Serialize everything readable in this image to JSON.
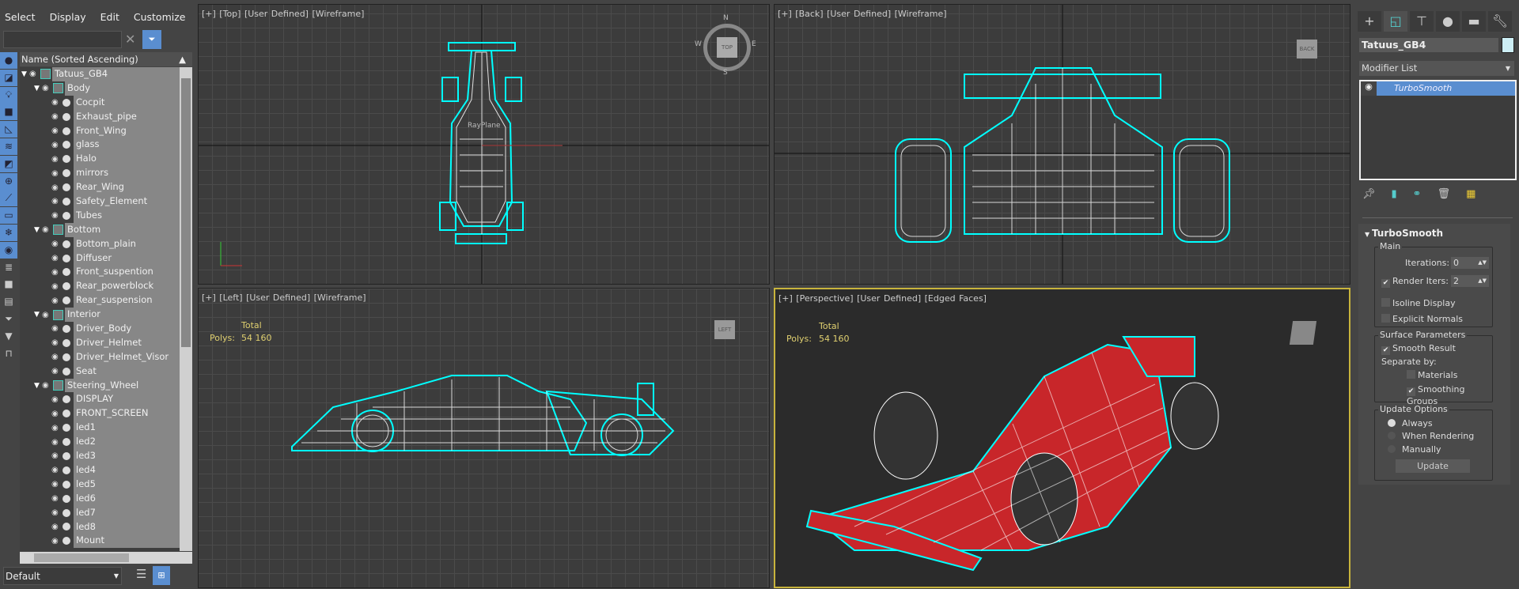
{
  "explorer": {
    "menu": [
      "Select",
      "Display",
      "Edit",
      "Customize"
    ],
    "search_value": "",
    "column_header": "Name (Sorted Ascending)",
    "tree": [
      {
        "label": "Tatuus_GB4",
        "level": 0,
        "type": "group"
      },
      {
        "label": "Body",
        "level": 1,
        "type": "group"
      },
      {
        "label": "Cocpit",
        "level": 2,
        "type": "object"
      },
      {
        "label": "Exhaust_pipe",
        "level": 2,
        "type": "object"
      },
      {
        "label": "Front_Wing",
        "level": 2,
        "type": "object"
      },
      {
        "label": "glass",
        "level": 2,
        "type": "object"
      },
      {
        "label": "Halo",
        "level": 2,
        "type": "object"
      },
      {
        "label": "mirrors",
        "level": 2,
        "type": "object"
      },
      {
        "label": "Rear_Wing",
        "level": 2,
        "type": "object"
      },
      {
        "label": "Safety_Element",
        "level": 2,
        "type": "object"
      },
      {
        "label": "Tubes",
        "level": 2,
        "type": "object"
      },
      {
        "label": "Bottom",
        "level": 1,
        "type": "group"
      },
      {
        "label": "Bottom_plain",
        "level": 2,
        "type": "object"
      },
      {
        "label": "Diffuser",
        "level": 2,
        "type": "object"
      },
      {
        "label": "Front_suspention",
        "level": 2,
        "type": "object"
      },
      {
        "label": "Rear_powerblock",
        "level": 2,
        "type": "object"
      },
      {
        "label": "Rear_suspension",
        "level": 2,
        "type": "object"
      },
      {
        "label": "Interior",
        "level": 1,
        "type": "group"
      },
      {
        "label": "Driver_Body",
        "level": 2,
        "type": "object"
      },
      {
        "label": "Driver_Helmet",
        "level": 2,
        "type": "object"
      },
      {
        "label": "Driver_Helmet_Visor",
        "level": 2,
        "type": "object"
      },
      {
        "label": "Seat",
        "level": 2,
        "type": "object"
      },
      {
        "label": "Steering_Wheel",
        "level": 1,
        "type": "group"
      },
      {
        "label": "DISPLAY",
        "level": 2,
        "type": "object"
      },
      {
        "label": "FRONT_SCREEN",
        "level": 2,
        "type": "object"
      },
      {
        "label": "led1",
        "level": 2,
        "type": "object"
      },
      {
        "label": "led2",
        "level": 2,
        "type": "object"
      },
      {
        "label": "led3",
        "level": 2,
        "type": "object"
      },
      {
        "label": "led4",
        "level": 2,
        "type": "object"
      },
      {
        "label": "led5",
        "level": 2,
        "type": "object"
      },
      {
        "label": "led6",
        "level": 2,
        "type": "object"
      },
      {
        "label": "led7",
        "level": 2,
        "type": "object"
      },
      {
        "label": "led8",
        "level": 2,
        "type": "object"
      },
      {
        "label": "Mount",
        "level": 2,
        "type": "object"
      }
    ],
    "layer_value": "Default"
  },
  "viewports": [
    {
      "label": "[+] [Top] [User Defined] [Wireframe]",
      "cube": "TOP"
    },
    {
      "label": "[+] [Back] [User Defined] [Wireframe]",
      "cube": "BACK"
    },
    {
      "label": "[+] [Left] [User Defined] [Wireframe]",
      "cube": "LEFT"
    },
    {
      "label": "[+] [Perspective] [User Defined] [Edged Faces]",
      "cube": ""
    }
  ],
  "stats": {
    "header": "Total",
    "label": "Polys:",
    "value": "54 160"
  },
  "compass": [
    "N",
    "W",
    "E",
    "S"
  ],
  "plane_label": "RayPlane",
  "command_panel": {
    "object_name": "Tatuus_GB4",
    "object_color": "#cdeef5",
    "modifier_list": "Modifier List",
    "stack": [
      "TurboSmooth"
    ],
    "rollout_title": "TurboSmooth",
    "main": {
      "title": "Main",
      "iterations_label": "Iterations:",
      "iterations": "0",
      "render_iters_label": "Render Iters:",
      "render_iters": "2",
      "render_iters_checked": true,
      "isoline": "Isoline Display",
      "isoline_checked": false,
      "explicit": "Explicit Normals",
      "explicit_checked": false
    },
    "surface": {
      "title": "Surface Parameters",
      "smooth": "Smooth Result",
      "smooth_checked": true,
      "separate": "Separate by:",
      "materials": "Materials",
      "materials_checked": false,
      "groups": "Smoothing Groups",
      "groups_checked": true
    },
    "update": {
      "title": "Update Options",
      "always": "Always",
      "rendering": "When Rendering",
      "manually": "Manually",
      "selected": "Always",
      "button": "Update"
    }
  },
  "colors": {
    "accent": "#5a8ed0",
    "selection": "#00ffff",
    "active_viewport": "#c8b43c",
    "car_red": "#c8262a"
  }
}
